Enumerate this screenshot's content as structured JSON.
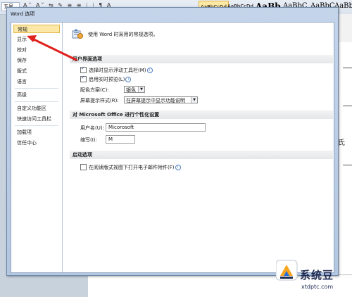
{
  "ribbon": {
    "font_size": "五号",
    "styles": [
      "AaBbCcDd",
      "AaBbCcDd",
      "AaBb",
      "AaBbC",
      "AaBbC",
      "AaBb"
    ]
  },
  "dialog": {
    "title": "Word 选项",
    "nav": [
      {
        "label": "常规",
        "active": true
      },
      {
        "label": "显示",
        "active": false
      },
      {
        "label": "校对",
        "active": false
      },
      {
        "label": "保存",
        "active": false
      },
      {
        "label": "版式",
        "active": false
      },
      {
        "label": "语言",
        "active": false
      },
      {
        "label": "高级",
        "active": false
      },
      {
        "label": "自定义功能区",
        "active": false
      },
      {
        "label": "快速访问工具栏",
        "active": false
      },
      {
        "label": "加载项",
        "active": false
      },
      {
        "label": "信任中心",
        "active": false
      }
    ],
    "header": "使用 Word 时采用的常规选项。",
    "sections": {
      "ui": "用户界面选项",
      "personalize": "对 Microsoft Office 进行个性化设置",
      "startup": "启动选项"
    },
    "options": {
      "mini_toolbar": {
        "label": "选择时显示浮动工具栏(M)",
        "checked": true
      },
      "live_preview": {
        "label": "启用实时预览(L)",
        "checked": true
      },
      "color_scheme_label": "配色方案(C):",
      "color_scheme_value": "银色",
      "tooltip_style_label": "屏幕提示样式(R):",
      "tooltip_style_value": "在屏幕提示中显示功能说明",
      "username_label": "用户名(U):",
      "username_value": "Micorosoft",
      "initials_label": "缩写(I):",
      "initials_value": "M",
      "reading_layout": {
        "label": "在阅读版式视图下打开电子邮件附件(F)",
        "checked": false
      }
    }
  },
  "document": {
    "visible_char": "氏"
  },
  "watermark": {
    "name": "系统豆",
    "url": "xtdptc.com"
  }
}
